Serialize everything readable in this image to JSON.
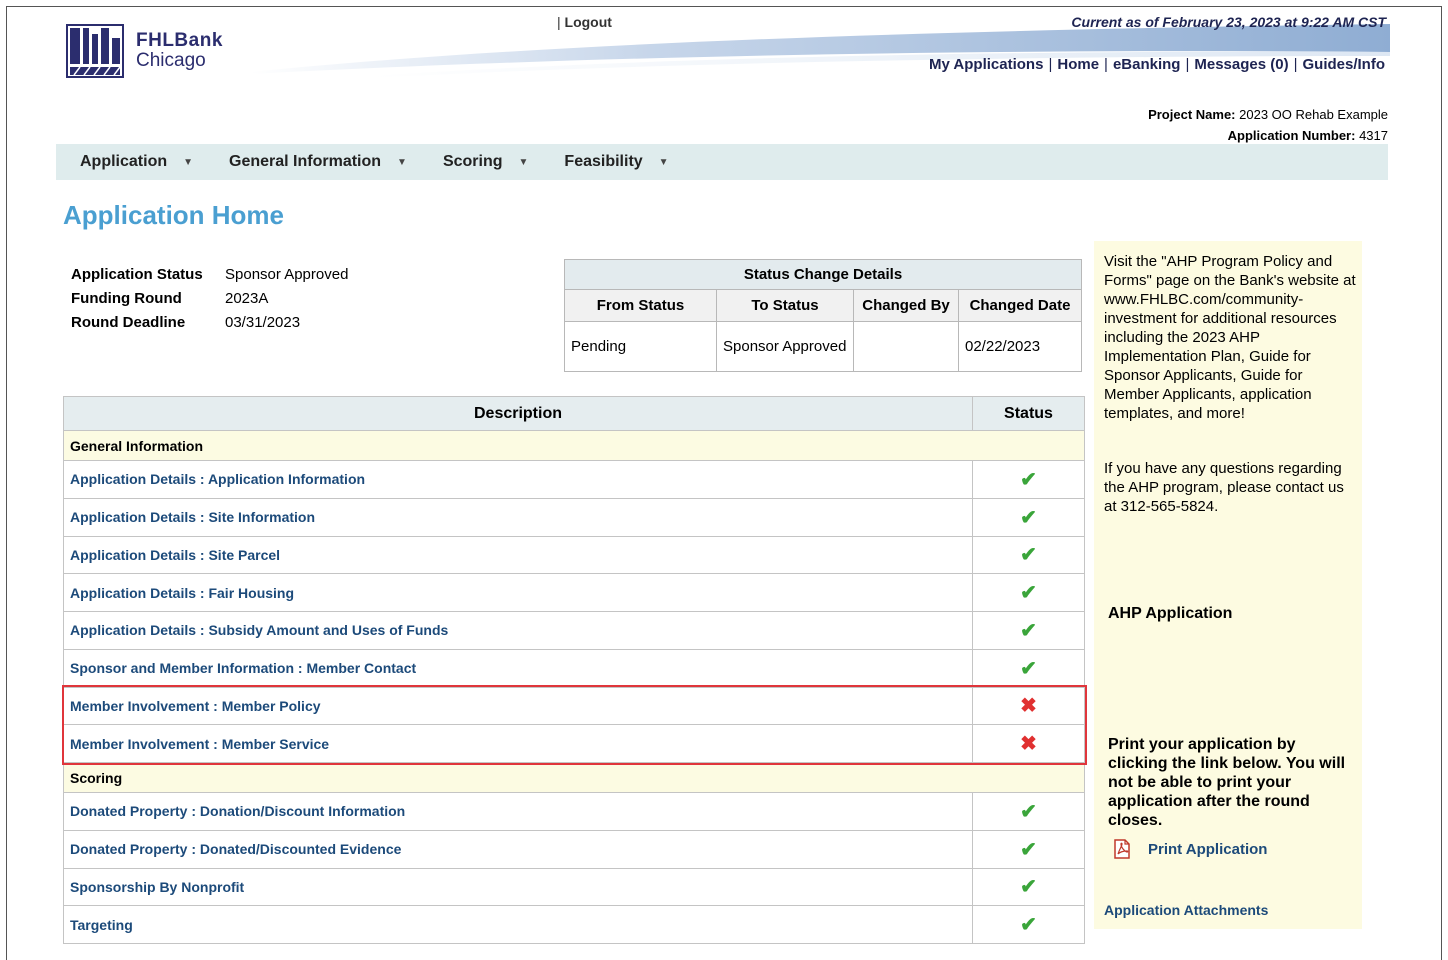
{
  "header": {
    "logo_line1": "FHLBank",
    "logo_line2": "Chicago",
    "logout": "Logout",
    "logout_sep": "|",
    "current_as_of": "Current as of February 23, 2023 at 9:22 AM CST",
    "nav": [
      "My Applications",
      "Home",
      "eBanking",
      "Messages (0)",
      "Guides/Info"
    ]
  },
  "project": {
    "name_label": "Project Name:",
    "name_value": "2023 OO Rehab Example",
    "number_label": "Application Number:",
    "number_value": "4317"
  },
  "menu": [
    "Application",
    "General Information",
    "Scoring",
    "Feasibility"
  ],
  "page_title": "Application Home",
  "summary": [
    {
      "label": "Application Status",
      "value": "Sponsor Approved"
    },
    {
      "label": "Funding Round",
      "value": "2023A"
    },
    {
      "label": "Round Deadline",
      "value": "03/31/2023"
    }
  ],
  "status_change": {
    "caption": "Status Change Details",
    "headers": [
      "From Status",
      "To Status",
      "Changed By",
      "Changed Date"
    ],
    "rows": [
      {
        "from": "Pending",
        "to": "Sponsor Approved",
        "by": "",
        "date": "02/22/2023"
      }
    ]
  },
  "main_table": {
    "headers": [
      "Description",
      "Status"
    ],
    "section_general": "General Information",
    "section_scoring": "Scoring",
    "general_rows": [
      {
        "desc": "Application Details : Application Information",
        "status": "complete"
      },
      {
        "desc": "Application Details : Site Information",
        "status": "complete"
      },
      {
        "desc": "Application Details : Site Parcel",
        "status": "complete"
      },
      {
        "desc": "Application Details : Fair Housing",
        "status": "complete"
      },
      {
        "desc": "Application Details : Subsidy Amount and Uses of Funds",
        "status": "complete"
      },
      {
        "desc": "Sponsor and Member Information : Member Contact",
        "status": "complete"
      },
      {
        "desc": "Member Involvement : Member Policy",
        "status": "incomplete"
      },
      {
        "desc": "Member Involvement : Member Service",
        "status": "incomplete"
      }
    ],
    "scoring_rows": [
      {
        "desc": "Donated Property : Donation/Discount Information",
        "status": "complete"
      },
      {
        "desc": "Donated Property : Donated/Discounted Evidence",
        "status": "complete"
      },
      {
        "desc": "Sponsorship By Nonprofit",
        "status": "complete"
      },
      {
        "desc": "Targeting",
        "status": "complete"
      }
    ],
    "check_glyph": "✔",
    "x_glyph": "✖"
  },
  "sidebar": {
    "p1": "Visit the \"AHP Program Policy and Forms\" page on the Bank's website at www.FHLBC.com/community-investment for additional resources including the 2023 AHP Implementation Plan, Guide for Sponsor Applicants, Guide for Member Applicants, application templates, and more!",
    "p2": "If you have any questions regarding the AHP program, please contact us at 312-565-5824.",
    "heading": "AHP Application",
    "print_note": "Print your application by clicking the link below. You will not be able to print your application after the round closes.",
    "print_link": "Print Application",
    "attachments_link": "Application Attachments"
  },
  "colors": {
    "title_blue": "#4a9fd1",
    "link_blue": "#1c4a7a",
    "menu_bg": "#dfeced",
    "sidebar_bg": "#fdfbe1",
    "highlight_red": "#e0353b",
    "check_green": "#3aa53a"
  }
}
